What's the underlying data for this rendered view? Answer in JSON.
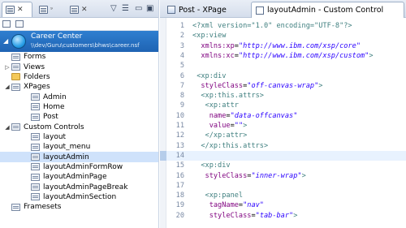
{
  "left_panel": {
    "tabs": [
      {
        "label": "",
        "icon": "applications-icon",
        "active": true
      },
      {
        "label": "",
        "icon": "package-explorer-icon",
        "active": false
      },
      {
        "label": "",
        "icon": "outline-icon",
        "active": false
      }
    ],
    "close_glyph": "✕",
    "toolbar_glyphs": {
      "menu": "▽",
      "minimize": "▭",
      "maximize": "▣",
      "lines": "☰"
    },
    "application": {
      "title": "Career Center",
      "path": "\\\\dev/Guru\\customers\\bhws\\career.nsf",
      "expanded": true
    },
    "tree": [
      {
        "label": "Forms",
        "indent": 1,
        "twisty": "",
        "icon": "form-icon"
      },
      {
        "label": "Views",
        "indent": 1,
        "twisty": "▷",
        "icon": "view-icon"
      },
      {
        "label": "Folders",
        "indent": 1,
        "twisty": "",
        "icon": "folder-icon"
      },
      {
        "label": "XPages",
        "indent": 1,
        "twisty": "◢",
        "icon": "xpages-icon"
      },
      {
        "label": "Admin",
        "indent": 2,
        "twisty": "",
        "icon": "xpage-icon"
      },
      {
        "label": "Home",
        "indent": 2,
        "twisty": "",
        "icon": "xpage-icon"
      },
      {
        "label": "Post",
        "indent": 2,
        "twisty": "",
        "icon": "xpage-icon"
      },
      {
        "label": "Custom Controls",
        "indent": 1,
        "twisty": "◢",
        "icon": "custom-controls-icon"
      },
      {
        "label": "layout",
        "indent": 2,
        "twisty": "",
        "icon": "custom-control-icon"
      },
      {
        "label": "layout_menu",
        "indent": 2,
        "twisty": "",
        "icon": "custom-control-icon"
      },
      {
        "label": "layoutAdmin",
        "indent": 2,
        "twisty": "",
        "icon": "custom-control-icon",
        "selected": true
      },
      {
        "label": "layoutAdminFormRow",
        "indent": 2,
        "twisty": "",
        "icon": "custom-control-icon"
      },
      {
        "label": "layoutAdminPage",
        "indent": 2,
        "twisty": "",
        "icon": "custom-control-icon"
      },
      {
        "label": "layoutAdminPageBreak",
        "indent": 2,
        "twisty": "",
        "icon": "custom-control-icon"
      },
      {
        "label": "layoutAdminSection",
        "indent": 2,
        "twisty": "",
        "icon": "custom-control-icon"
      },
      {
        "label": "Framesets",
        "indent": 1,
        "twisty": "",
        "icon": "frameset-icon"
      }
    ]
  },
  "editor": {
    "tabs": [
      {
        "label": "Post - XPage",
        "active": false,
        "icon": "xpage-tab-icon"
      },
      {
        "label": "layoutAdmin - Custom Control",
        "active": true,
        "icon": "custom-control-tab-icon"
      }
    ],
    "highlighted_line": 14,
    "lines": [
      {
        "n": "1",
        "parts": [
          [
            "pi",
            "<?xml version=\"1.0\" encoding=\"UTF-8\"?>"
          ]
        ]
      },
      {
        "n": "2",
        "parts": [
          [
            "tag",
            "<xp:view"
          ]
        ]
      },
      {
        "n": "3",
        "parts": [
          [
            "pun",
            "  "
          ],
          [
            "attr",
            "xmlns:xp"
          ],
          [
            "pun",
            "="
          ],
          [
            "val",
            "\"http://www.ibm.com/xsp/core\""
          ]
        ]
      },
      {
        "n": "4",
        "parts": [
          [
            "pun",
            "  "
          ],
          [
            "attr",
            "xmlns:xc"
          ],
          [
            "pun",
            "="
          ],
          [
            "val",
            "\"http://www.ibm.com/xsp/custom\""
          ],
          [
            "tag",
            ">"
          ]
        ]
      },
      {
        "n": "5",
        "parts": []
      },
      {
        "n": "6",
        "parts": [
          [
            "pun",
            " "
          ],
          [
            "tag",
            "<xp:div"
          ]
        ]
      },
      {
        "n": "7",
        "parts": [
          [
            "pun",
            "  "
          ],
          [
            "attr",
            "styleClass"
          ],
          [
            "pun",
            "="
          ],
          [
            "val",
            "\"off-canvas-wrap\""
          ],
          [
            "tag",
            ">"
          ]
        ]
      },
      {
        "n": "8",
        "parts": [
          [
            "pun",
            "  "
          ],
          [
            "tag",
            "<xp:this.attrs>"
          ]
        ]
      },
      {
        "n": "9",
        "parts": [
          [
            "pun",
            "   "
          ],
          [
            "tag",
            "<xp:attr"
          ]
        ]
      },
      {
        "n": "10",
        "parts": [
          [
            "pun",
            "    "
          ],
          [
            "attr",
            "name"
          ],
          [
            "pun",
            "="
          ],
          [
            "val",
            "\"data-offcanvas\""
          ]
        ]
      },
      {
        "n": "11",
        "parts": [
          [
            "pun",
            "    "
          ],
          [
            "attr",
            "value"
          ],
          [
            "pun",
            "="
          ],
          [
            "val",
            "\"\""
          ],
          [
            "tag",
            ">"
          ]
        ]
      },
      {
        "n": "12",
        "parts": [
          [
            "pun",
            "   "
          ],
          [
            "tag",
            "</xp:attr>"
          ]
        ]
      },
      {
        "n": "13",
        "parts": [
          [
            "pun",
            "  "
          ],
          [
            "tag",
            "</xp:this.attrs>"
          ]
        ]
      },
      {
        "n": "14",
        "parts": []
      },
      {
        "n": "15",
        "parts": [
          [
            "pun",
            "  "
          ],
          [
            "tag",
            "<xp:div"
          ]
        ]
      },
      {
        "n": "16",
        "parts": [
          [
            "pun",
            "   "
          ],
          [
            "attr",
            "styleClass"
          ],
          [
            "pun",
            "="
          ],
          [
            "val",
            "\"inner-wrap\""
          ],
          [
            "tag",
            ">"
          ]
        ]
      },
      {
        "n": "17",
        "parts": []
      },
      {
        "n": "18",
        "parts": [
          [
            "pun",
            "   "
          ],
          [
            "tag",
            "<xp:panel"
          ]
        ]
      },
      {
        "n": "19",
        "parts": [
          [
            "pun",
            "    "
          ],
          [
            "attr",
            "tagName"
          ],
          [
            "pun",
            "="
          ],
          [
            "val",
            "\"nav\""
          ]
        ]
      },
      {
        "n": "20",
        "parts": [
          [
            "pun",
            "    "
          ],
          [
            "attr",
            "styleClass"
          ],
          [
            "pun",
            "="
          ],
          [
            "val",
            "\"tab-bar\""
          ],
          [
            "tag",
            ">"
          ]
        ]
      }
    ]
  },
  "colors": {
    "accent": "#1f63b3",
    "tag": "#3f7f7f",
    "attr": "#7f007f",
    "value": "#2a00ff",
    "selection": "#cfe2fb"
  }
}
